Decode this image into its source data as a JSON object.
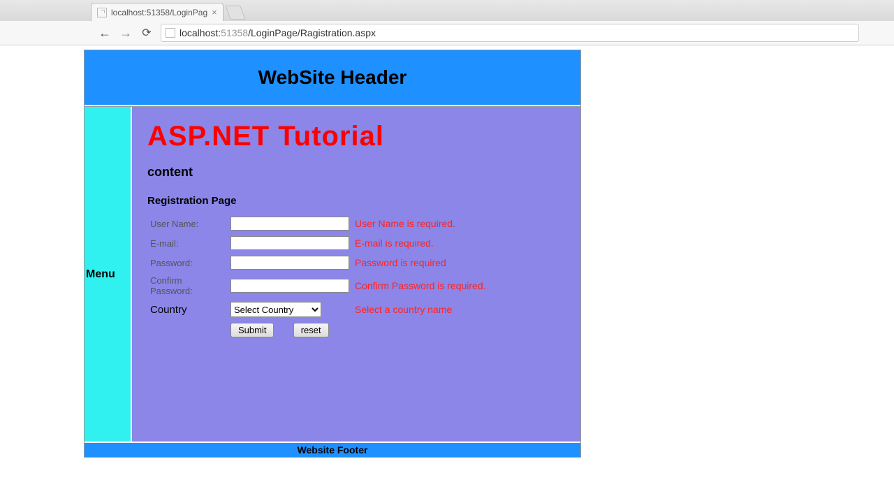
{
  "browser": {
    "tab_title": "localhost:51358/LoginPag",
    "url_host": "localhost:",
    "url_port": "51358",
    "url_path": "/LoginPage/Ragistration.aspx"
  },
  "site": {
    "header": "WebSite Header",
    "menu_label": "Menu",
    "footer": "Website Footer"
  },
  "content": {
    "tutorial_title": "ASP.NET Tutorial",
    "content_heading": "content",
    "page_heading": "Registration Page",
    "fields": {
      "username_label": "User Name:",
      "username_error": "User Name is required.",
      "email_label": "E-mail:",
      "email_error": "E-mail is required.",
      "password_label": "Password:",
      "password_error": "Password is required",
      "confirm_label": "Confirm Password:",
      "confirm_error": "Confirm Password is required.",
      "country_label": "Country",
      "country_selected": "Select Country",
      "country_error": "Select a country name"
    },
    "buttons": {
      "submit": "Submit",
      "reset": "reset"
    }
  }
}
